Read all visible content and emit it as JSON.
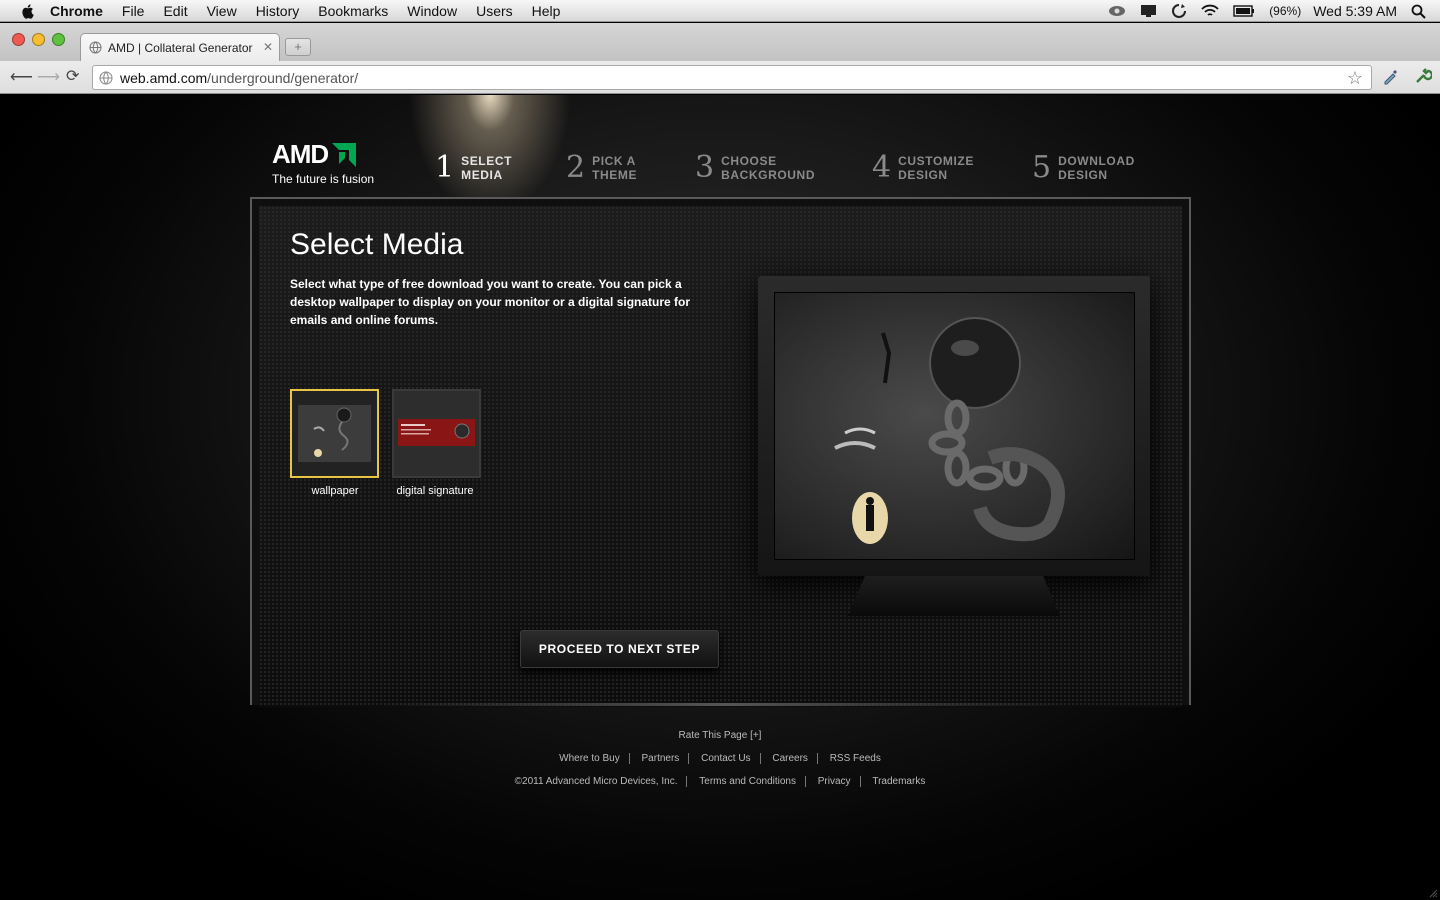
{
  "mac_menubar": {
    "app_name": "Chrome",
    "menus": [
      "File",
      "Edit",
      "View",
      "History",
      "Bookmarks",
      "Window",
      "Users",
      "Help"
    ],
    "battery": "(96%)",
    "clock": "Wed 5:39 AM"
  },
  "browser": {
    "tab_title": "AMD | Collateral Generator",
    "url_host": "web.amd.com",
    "url_path": "/underground/generator/"
  },
  "site": {
    "logo_text": "AMD",
    "logo_tagline": "The future is fusion",
    "accent_color": "#00a651",
    "steps": [
      {
        "num": "1",
        "label": "SELECT\nMEDIA",
        "active": true
      },
      {
        "num": "2",
        "label": "PICK A\nTHEME",
        "active": false
      },
      {
        "num": "3",
        "label": "CHOOSE\nBACKGROUND",
        "active": false
      },
      {
        "num": "4",
        "label": "CUSTOMIZE\nDESIGN",
        "active": false
      },
      {
        "num": "5",
        "label": "DOWNLOAD\nDESIGN",
        "active": false
      }
    ],
    "panel": {
      "title": "Select Media",
      "description": "Select what type of free download you want to create. You can pick a desktop wallpaper to display on your monitor or a digital signature for emails and online forums.",
      "media_options": [
        {
          "label": "wallpaper",
          "selected": true
        },
        {
          "label": "digital signature",
          "selected": false
        }
      ],
      "selected_color": "#e9c544",
      "proceed_label": "PROCEED TO NEXT STEP"
    },
    "footer": {
      "rate": "Rate This Page",
      "rate_icon": "[+]",
      "links_row1": [
        "Where to Buy",
        "Partners",
        "Contact Us",
        "Careers",
        "RSS Feeds"
      ],
      "copyright": "©2011 Advanced Micro Devices, Inc.",
      "links_row2": [
        "Terms and Conditions",
        "Privacy",
        "Trademarks"
      ]
    }
  }
}
